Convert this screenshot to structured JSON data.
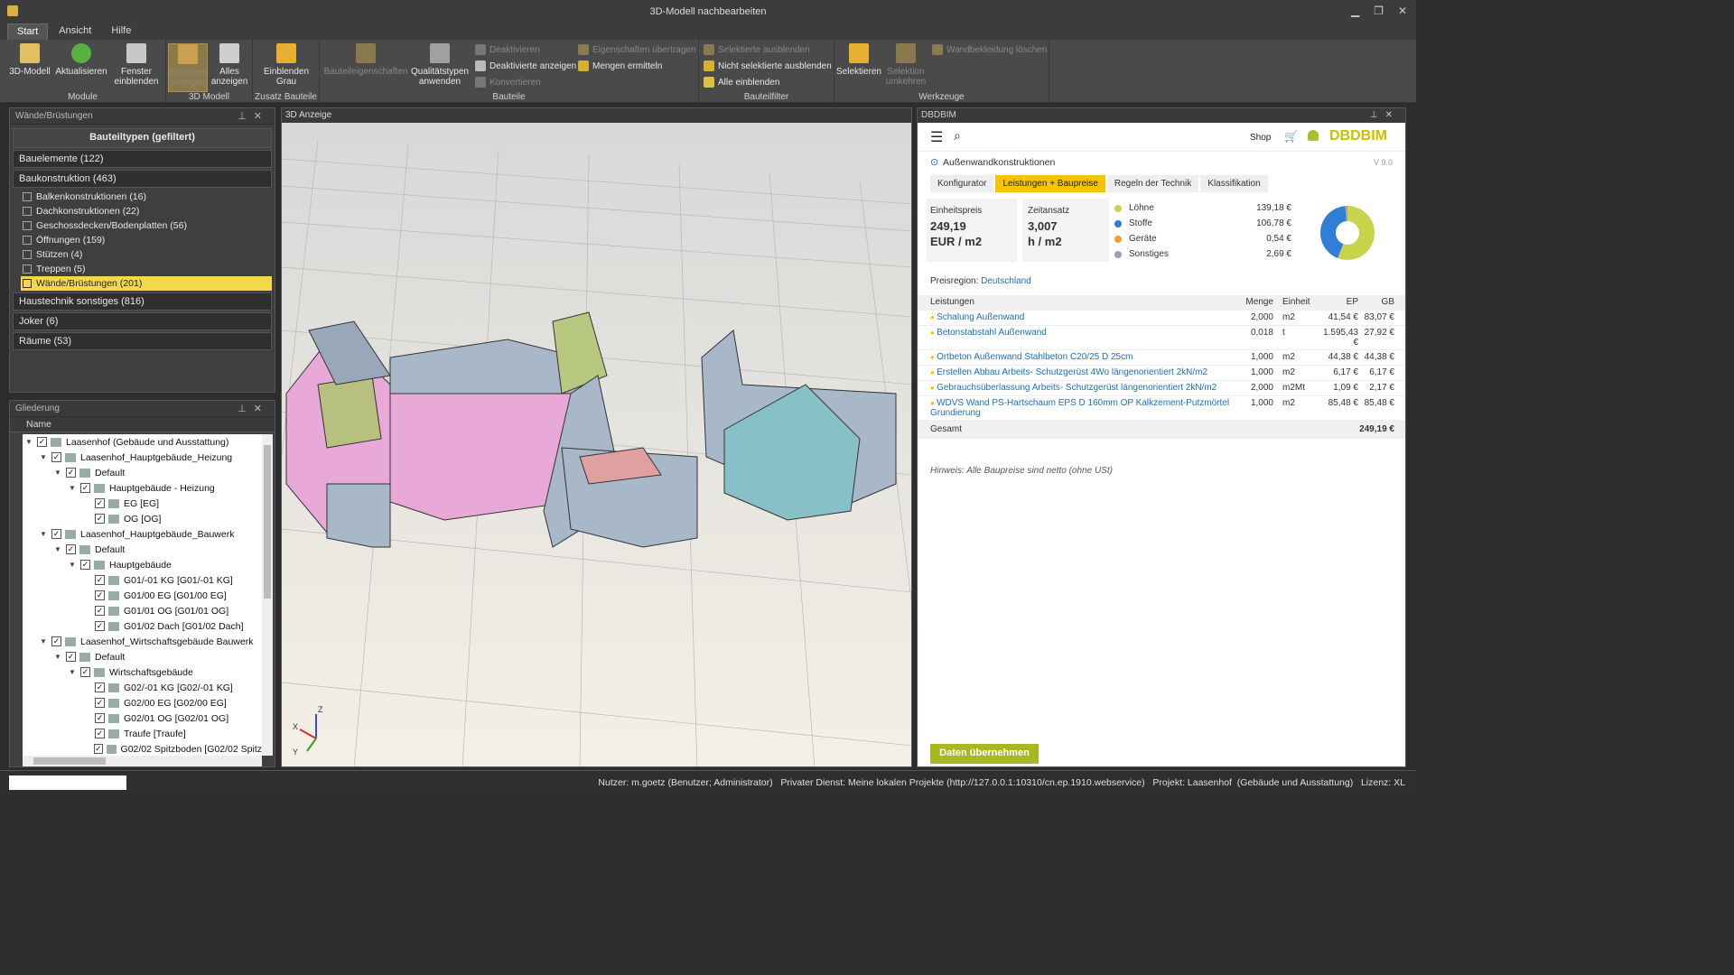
{
  "window": {
    "title": "3D-Modell nachbearbeiten",
    "minimize": "▁",
    "restore": "❐",
    "close": "✕"
  },
  "tabs": [
    "Start",
    "Ansicht",
    "Hilfe"
  ],
  "ribbon": {
    "module": {
      "label": "Module",
      "btn_3d": "3D-Modell",
      "btn_aktualisieren": "Aktualisieren",
      "btn_fenster": "Fenster einblenden"
    },
    "modell3d": {
      "label": "3D Modell",
      "btn_konturen": "Konturen anzeigen",
      "btn_alles": "Alles anzeigen"
    },
    "zusatz": {
      "label": "Zusatz Bauteile",
      "btn_einblenden": "Einblenden Grau"
    },
    "bauteile": {
      "label": "Bauteile",
      "btn_eigenschaften": "Bauteileigenschaften",
      "btn_qualitaet": "Qualitätstypen anwenden",
      "deaktivieren": "Deaktivieren",
      "deaktivierte": "Deaktivierte anzeigen",
      "konvertieren": "Konvertieren",
      "eig_uebertragen": "Eigenschaften übertragen",
      "mengen": "Mengen ermitteln"
    },
    "filter": {
      "label": "Bauteilfilter",
      "sel_aus": "Selektierte ausblenden",
      "nicht_sel": "Nicht selektierte ausblenden",
      "alle": "Alle einblenden"
    },
    "werkzeuge": {
      "label": "Werkzeuge",
      "btn_selektieren": "Selektieren",
      "btn_umkehren": "Selektion umkehren",
      "wandbekleidung": "Wandbekleidung löschen"
    }
  },
  "left_panel": {
    "title": "Wände/Brüstungen",
    "header": "Bauteiltypen (gefiltert)",
    "categories": [
      {
        "label": "Bauelemente (122)"
      },
      {
        "label": "Baukonstruktion (463)"
      }
    ],
    "subitems": [
      "Balkenkonstruktionen (16)",
      "Dachkonstruktionen (22)",
      "Geschossdecken/Bodenplatten (56)",
      "Öffnungen (159)",
      "Stützen (4)",
      "Treppen (5)",
      "Wände/Brüstungen (201)"
    ],
    "categories2": [
      "Haustechnik sonstiges (816)",
      "Joker (6)",
      "Räume (53)"
    ]
  },
  "outline_panel": {
    "title": "Gliederung",
    "col_name": "Name",
    "rows": [
      {
        "indent": 0,
        "label": "Laasenhof  (Gebäude und Ausstattung)"
      },
      {
        "indent": 1,
        "label": "Laasenhof_Hauptgebäude_Heizung"
      },
      {
        "indent": 2,
        "label": "Default"
      },
      {
        "indent": 3,
        "label": "Hauptgebäude - Heizung"
      },
      {
        "indent": 4,
        "label": "EG [EG]"
      },
      {
        "indent": 4,
        "label": "OG [OG]"
      },
      {
        "indent": 1,
        "label": "Laasenhof_Hauptgebäude_Bauwerk"
      },
      {
        "indent": 2,
        "label": "Default"
      },
      {
        "indent": 3,
        "label": "Hauptgebäude"
      },
      {
        "indent": 4,
        "label": "G01/-01 KG [G01/-01 KG]"
      },
      {
        "indent": 4,
        "label": "G01/00 EG [G01/00 EG]"
      },
      {
        "indent": 4,
        "label": "G01/01 OG [G01/01 OG]"
      },
      {
        "indent": 4,
        "label": "G01/02 Dach [G01/02 Dach]"
      },
      {
        "indent": 1,
        "label": "Laasenhof_Wirtschaftsgebäude Bauwerk"
      },
      {
        "indent": 2,
        "label": "Default"
      },
      {
        "indent": 3,
        "label": "Wirtschaftsgebäude"
      },
      {
        "indent": 4,
        "label": "G02/-01 KG [G02/-01 KG]"
      },
      {
        "indent": 4,
        "label": "G02/00 EG [G02/00 EG]"
      },
      {
        "indent": 4,
        "label": "G02/01 OG [G02/01 OG]"
      },
      {
        "indent": 4,
        "label": "Traufe [Traufe]"
      },
      {
        "indent": 4,
        "label": "G02/02 Spitzboden [G02/02 Spitz"
      }
    ]
  },
  "view3d": {
    "title": "3D Anzeige",
    "axis_z": "Z",
    "axis_y": "Y",
    "axis_x": "X"
  },
  "dbd": {
    "title": "DBDBIM",
    "shop": "Shop",
    "brand": "DBDBIM",
    "back": "Außenwandkonstruktionen",
    "version": "V 9.0",
    "tabs": [
      "Konfigurator",
      "Leistungen + Baupreise",
      "Regeln der Technik",
      "Klassifikation"
    ],
    "einheitspreis_label": "Einheitspreis",
    "einheitspreis_value": "249,19",
    "einheitspreis_unit": "EUR / m2",
    "zeitansatz_label": "Zeitansatz",
    "zeitansatz_value": "3,007",
    "zeitansatz_unit": "h / m2",
    "breakdown": [
      {
        "label": "Löhne",
        "value": "139,18 €",
        "color": "#c8d44a",
        "amount": 139.18
      },
      {
        "label": "Stoffe",
        "value": "106,78 €",
        "color": "#2f7fd6",
        "amount": 106.78
      },
      {
        "label": "Geräte",
        "value": "0,54 €",
        "color": "#f0a030",
        "amount": 0.54
      },
      {
        "label": "Sonstiges",
        "value": "2,69 €",
        "color": "#9aa0b8",
        "amount": 2.69
      }
    ],
    "region_label": "Preisregion:",
    "region_value": "Deutschland",
    "table_head": {
      "c1": "Leistungen",
      "c2": "Menge",
      "c3": "Einheit",
      "c4": "EP",
      "c5": "GB"
    },
    "rows": [
      {
        "c1": "Schalung Außenwand",
        "c2": "2,000",
        "c3": "m2",
        "c4": "41,54 €",
        "c5": "83,07 €"
      },
      {
        "c1": "Betonstabstahl Außenwand",
        "c2": "0,018",
        "c3": "t",
        "c4": "1.595,43 €",
        "c5": "27,92 €"
      },
      {
        "c1": "Ortbeton Außenwand Stahlbeton C20/25 D 25cm",
        "c2": "1,000",
        "c3": "m2",
        "c4": "44,38 €",
        "c5": "44,38 €"
      },
      {
        "c1": "Erstellen Abbau Arbeits- Schutzgerüst 4Wo längenorientiert 2kN/m2",
        "c2": "1,000",
        "c3": "m2",
        "c4": "6,17 €",
        "c5": "6,17 €"
      },
      {
        "c1": "Gebrauchsüberlassung Arbeits- Schutzgerüst längenorientiert 2kN/m2",
        "c2": "2,000",
        "c3": "m2Mt",
        "c4": "1,09 €",
        "c5": "2,17 €"
      },
      {
        "c1": "WDVS Wand PS-Hartschaum EPS D 160mm OP Kalkzement-Putzmörtel Grundierung",
        "c2": "1,000",
        "c3": "m2",
        "c4": "85,48 €",
        "c5": "85,48 €"
      }
    ],
    "total_label": "Gesamt",
    "total_value": "249,19 €",
    "hint": "Hinweis: Alle Baupreise sind netto (ohne USt)",
    "apply_button": "Daten übernehmen"
  },
  "status": "Nutzer: m.goetz (Benutzer; Administrator)   Privater Dienst: Meine lokalen Projekte (http://127.0.0.1:10310/cn.ep.1910.webservice)   Projekt: Laasenhof  (Gebäude und Ausstattung)   Lizenz: XL"
}
